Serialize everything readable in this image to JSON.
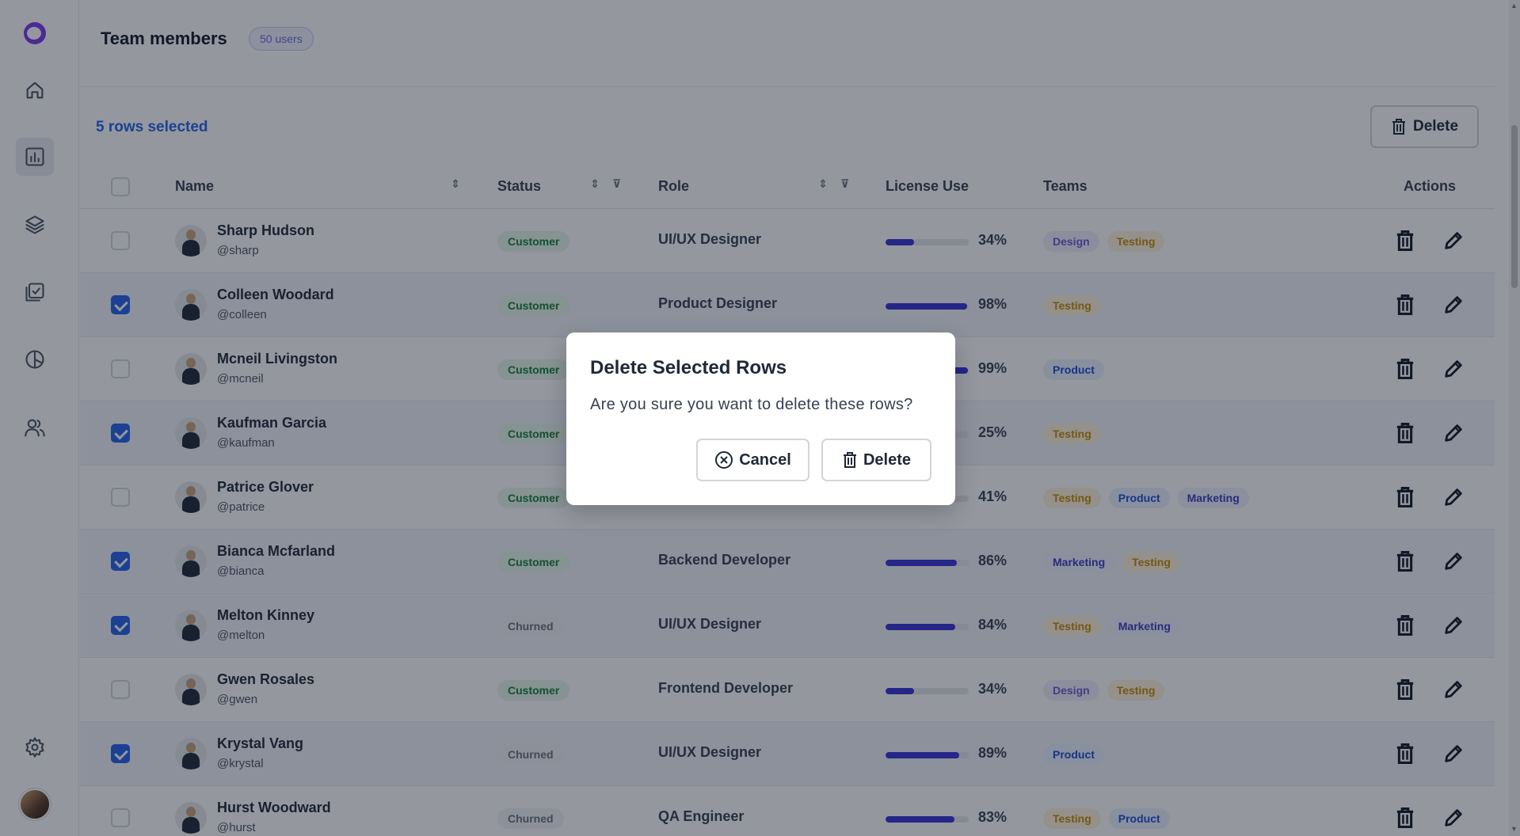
{
  "header": {
    "title": "Team members",
    "user_count": "50 users"
  },
  "toolbar": {
    "selected_text": "5 rows selected",
    "delete_label": "Delete"
  },
  "table": {
    "columns": {
      "name": "Name",
      "status": "Status",
      "role": "Role",
      "license": "License Use",
      "teams": "Teams",
      "actions": "Actions"
    },
    "rows": [
      {
        "name": "Sharp Hudson",
        "handle": "@sharp",
        "status": "Customer",
        "role": "UI/UX Designer",
        "license": 34,
        "license_label": "34%",
        "teams": [
          "Design",
          "Testing"
        ],
        "selected": false
      },
      {
        "name": "Colleen Woodard",
        "handle": "@colleen",
        "status": "Customer",
        "role": "Product Designer",
        "license": 98,
        "license_label": "98%",
        "teams": [
          "Testing"
        ],
        "selected": true
      },
      {
        "name": "Mcneil Livingston",
        "handle": "@mcneil",
        "status": "Customer",
        "role": "",
        "license": 99,
        "license_label": "99%",
        "teams": [
          "Product"
        ],
        "selected": false
      },
      {
        "name": "Kaufman Garcia",
        "handle": "@kaufman",
        "status": "Customer",
        "role": "",
        "license": 25,
        "license_label": "25%",
        "teams": [
          "Testing"
        ],
        "selected": true
      },
      {
        "name": "Patrice Glover",
        "handle": "@patrice",
        "status": "Customer",
        "role": "",
        "license": 41,
        "license_label": "41%",
        "teams": [
          "Testing",
          "Product",
          "Marketing"
        ],
        "selected": false
      },
      {
        "name": "Bianca Mcfarland",
        "handle": "@bianca",
        "status": "Customer",
        "role": "Backend Developer",
        "license": 86,
        "license_label": "86%",
        "teams": [
          "Marketing",
          "Testing"
        ],
        "selected": true
      },
      {
        "name": "Melton Kinney",
        "handle": "@melton",
        "status": "Churned",
        "role": "UI/UX Designer",
        "license": 84,
        "license_label": "84%",
        "teams": [
          "Testing",
          "Marketing"
        ],
        "selected": true
      },
      {
        "name": "Gwen Rosales",
        "handle": "@gwen",
        "status": "Customer",
        "role": "Frontend Developer",
        "license": 34,
        "license_label": "34%",
        "teams": [
          "Design",
          "Testing"
        ],
        "selected": false
      },
      {
        "name": "Krystal Vang",
        "handle": "@krystal",
        "status": "Churned",
        "role": "UI/UX Designer",
        "license": 89,
        "license_label": "89%",
        "teams": [
          "Product"
        ],
        "selected": true
      },
      {
        "name": "Hurst Woodward",
        "handle": "@hurst",
        "status": "Churned",
        "role": "QA Engineer",
        "license": 83,
        "license_label": "83%",
        "teams": [
          "Testing",
          "Product"
        ],
        "selected": false
      }
    ]
  },
  "modal": {
    "title": "Delete Selected Rows",
    "message": "Are you sure you want to delete these rows?",
    "cancel_label": "Cancel",
    "delete_label": "Delete"
  },
  "icons": {
    "sidebar": [
      "home-icon",
      "chart-icon",
      "layers-icon",
      "checklist-icon",
      "pie-icon",
      "users-icon",
      "settings-icon"
    ]
  },
  "colors": {
    "accent": "#2563eb",
    "progress": "#3730d8",
    "brand": "#7c3aed"
  }
}
